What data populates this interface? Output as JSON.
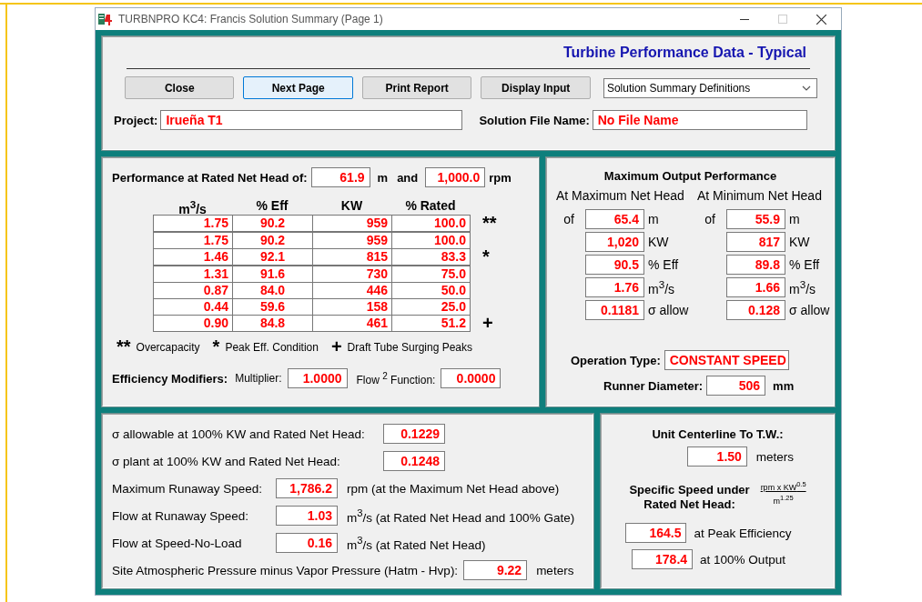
{
  "window": {
    "title": "TURBNPRO KC4:  Francis Solution Summary (Page 1)"
  },
  "header": {
    "title": "Turbine Performance Data - Typical",
    "buttons": [
      {
        "label": "Close",
        "focused": false
      },
      {
        "label": "Next Page",
        "focused": true
      },
      {
        "label": "Print Report",
        "focused": false
      },
      {
        "label": "Display Input",
        "focused": false
      }
    ],
    "dropdown": {
      "value": "Solution Summary Definitions"
    },
    "project": {
      "label": "Project:",
      "value": "Irueña T1"
    },
    "solution_file": {
      "label": "Solution File Name:",
      "value": "No File Name"
    }
  },
  "rated": {
    "label": "Performance at Rated Net Head of:",
    "head": "61.9",
    "head_unit": "m",
    "joiner": "and",
    "speed": "1,000.0",
    "speed_unit": "rpm",
    "table": {
      "columns": [
        "m$^{3}$/s",
        "% Eff",
        "KW",
        "% Rated"
      ],
      "rows": [
        {
          "cells": [
            "1.75",
            "90.2",
            "959",
            "100.0"
          ],
          "note": "**"
        },
        {
          "cells": [
            "1.75",
            "90.2",
            "959",
            "100.0"
          ]
        },
        {
          "cells": [
            "1.46",
            "92.1",
            "815",
            "83.3"
          ],
          "note": "*"
        },
        {
          "cells": [
            "1.31",
            "91.6",
            "730",
            "75.0"
          ]
        },
        {
          "cells": [
            "0.87",
            "84.0",
            "446",
            "50.0"
          ]
        },
        {
          "cells": [
            "0.44",
            "59.6",
            "158",
            "25.0"
          ]
        },
        {
          "cells": [
            "0.90",
            "84.8",
            "461",
            "51.2"
          ],
          "note": "+"
        }
      ]
    },
    "legend": [
      {
        "symbol": "**",
        "text": "Overcapacity"
      },
      {
        "symbol": "*",
        "text": "Peak Eff. Condition"
      },
      {
        "symbol": "+",
        "text": "Draft Tube Surging Peaks"
      }
    ],
    "modifiers": {
      "label": "Efficiency Modifiers:",
      "multiplier_label": "Multiplier:",
      "multiplier": "1.0000",
      "flow_label": "Flow $^{2}$ Function:",
      "flow": "0.0000"
    }
  },
  "max_output": {
    "title": "Maximum Output Performance",
    "columns": [
      {
        "heading": "At Maximum Net Head",
        "of": "of",
        "head": "65.4",
        "head_unit": "m",
        "rows": [
          {
            "value": "1,020",
            "unit": "KW"
          },
          {
            "value": "90.5",
            "unit": "% Eff"
          },
          {
            "value": "1.76",
            "unit": "m$^{3}$/s"
          },
          {
            "value": "0.1181",
            "unit": "σ allow"
          }
        ]
      },
      {
        "heading": "At Minimum Net Head",
        "of": "of",
        "head": "55.9",
        "head_unit": "m",
        "rows": [
          {
            "value": "817",
            "unit": "KW"
          },
          {
            "value": "89.8",
            "unit": "% Eff"
          },
          {
            "value": "1.66",
            "unit": "m$^{3}$/s"
          },
          {
            "value": "0.128",
            "unit": "σ allow"
          }
        ]
      }
    ],
    "operation_type": {
      "label": "Operation Type:",
      "value": "CONSTANT SPEED"
    },
    "runner_diameter": {
      "label": "Runner Diameter:",
      "value": "506",
      "unit": "mm"
    }
  },
  "cavitation": {
    "rows": [
      {
        "kind": "sigma",
        "label": "σ allowable at 100% KW and Rated Net Head:",
        "value": "0.1229"
      },
      {
        "kind": "sigma",
        "label": "σ plant at 100% KW and Rated Net Head:",
        "value": "0.1248"
      },
      {
        "kind": "speed",
        "label": "Maximum Runaway Speed:",
        "value": "1,786.2",
        "unit": "rpm (at the Maximum Net Head above)"
      },
      {
        "kind": "speed",
        "label": "Flow at Runaway Speed:",
        "value": "1.03",
        "unit": "m$^{3}$/s (at Rated Net Head and 100% Gate)"
      },
      {
        "kind": "speed",
        "label": "Flow at Speed-No-Load",
        "value": "0.16",
        "unit": "m$^{3}$/s (at Rated Net Head)"
      },
      {
        "kind": "site",
        "label": "Site Atmospheric Pressure minus Vapor Pressure (Hatm - Hvp):",
        "value": "9.22",
        "unit": "meters"
      }
    ]
  },
  "specific": {
    "centerline_label": "Unit Centerline To T.W.:",
    "centerline": "1.50",
    "centerline_unit": "meters",
    "speed_label": [
      "Specific Speed under",
      "Rated Net Head:"
    ],
    "unit_numerator": "rpm x KW$^{0.5}$",
    "unit_denominator": "m$^{1.25}$",
    "rows": [
      {
        "value": "164.5",
        "label": "at Peak Efficiency"
      },
      {
        "value": "178.4",
        "label": "at 100% Output"
      }
    ]
  }
}
